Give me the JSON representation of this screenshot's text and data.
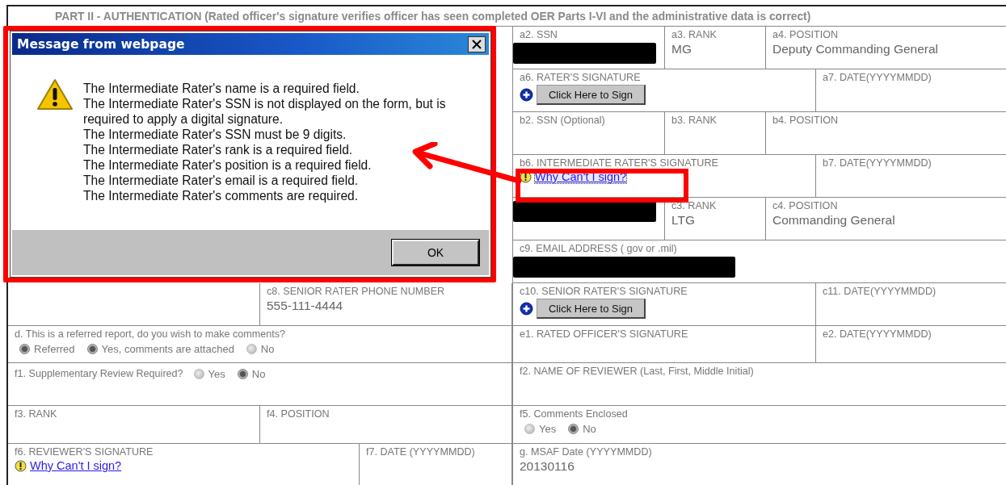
{
  "form": {
    "title": "PART II - AUTHENTICATION (Rated officer's signature verifies officer has seen completed OER Parts I-VI and the administrative data is correct)",
    "top_right_rows": [
      [
        {
          "kind": "redacted",
          "label": "a2. SSN"
        },
        {
          "kind": "field",
          "label": "a3. RANK",
          "value": "MG"
        },
        {
          "kind": "field",
          "label": "a4. POSITION",
          "value": "Deputy Commanding General"
        }
      ],
      [
        {
          "kind": "sign",
          "label": "a6. RATER'S SIGNATURE",
          "button": "Click Here to Sign"
        },
        {
          "kind": "field",
          "label": "a7. DATE(YYYYMMDD)"
        }
      ],
      [
        {
          "kind": "field",
          "label": "b2. SSN (Optional)"
        },
        {
          "kind": "field",
          "label": "b3. RANK"
        },
        {
          "kind": "field",
          "label": "b4. POSITION"
        }
      ],
      [
        {
          "kind": "help",
          "label": "b6. INTERMEDIATE RATER'S SIGNATURE",
          "link": "Why Can't I sign?"
        },
        {
          "kind": "field",
          "label": "b7. DATE(YYYYMMDD)"
        }
      ],
      [
        {
          "kind": "redacted"
        },
        {
          "kind": "field",
          "label": "c3. RANK",
          "value": "LTG"
        },
        {
          "kind": "field",
          "label": "c4. POSITION",
          "value": "Commanding General"
        }
      ],
      [
        {
          "kind": "redacted",
          "label": "c9. EMAIL ADDRESS ( gov or .mil)"
        }
      ]
    ],
    "bottom_rows": [
      {
        "left": [
          {
            "kind": "field"
          },
          {
            "kind": "field",
            "label": "c8. SENIOR RATER PHONE NUMBER",
            "value": "555-111-4444"
          }
        ],
        "right": [
          {
            "kind": "sign",
            "label": "c10. SENIOR RATER'S SIGNATURE",
            "button": "Click Here to Sign"
          },
          {
            "kind": "field",
            "label": "c11. DATE(YYYYMMDD)"
          }
        ]
      },
      {
        "left": [
          {
            "kind": "radio",
            "label": "d. This is a referred report, do you wish to make comments?",
            "options": [
              {
                "label": "Referred",
                "selected": true
              },
              {
                "label": "Yes, comments are attached",
                "selected": true
              },
              {
                "label": "No",
                "selected": false
              }
            ]
          }
        ],
        "right": [
          {
            "kind": "field",
            "label": "e1. RATED OFFICER'S SIGNATURE"
          },
          {
            "kind": "field",
            "label": "e2. DATE(YYYYMMDD)"
          }
        ]
      },
      {
        "left": [
          {
            "kind": "radio_inline",
            "label": "f1. Supplementary Review Required?",
            "options": [
              {
                "label": "Yes",
                "selected": false
              },
              {
                "label": "No",
                "selected": true
              }
            ]
          }
        ],
        "right": [
          {
            "kind": "field",
            "label": "f2. NAME OF REVIEWER (Last, First, Middle Initial)"
          }
        ]
      },
      {
        "left": [
          {
            "kind": "field",
            "label": "f3. RANK"
          },
          {
            "kind": "field",
            "label": "f4. POSITION"
          }
        ],
        "right": [
          {
            "kind": "radio",
            "label": "f5. Comments Enclosed",
            "options": [
              {
                "label": "Yes",
                "selected": false
              },
              {
                "label": "No",
                "selected": true
              }
            ]
          }
        ]
      },
      {
        "left": [
          {
            "kind": "help",
            "label": "f6. REVIEWER'S SIGNATURE",
            "link": "Why Can't I sign?"
          },
          {
            "kind": "field",
            "label": "f7. DATE (YYYYMMDD)"
          }
        ],
        "right": [
          {
            "kind": "field",
            "label": "g. MSAF Date (YYYYMMDD)",
            "value": "20130116"
          }
        ]
      }
    ]
  },
  "dialog": {
    "title": "Message from webpage",
    "messages": [
      "The Intermediate Rater's name is a required field.",
      "The Intermediate Rater's SSN is not displayed on the form, but is required to apply a digital signature.",
      "The Intermediate Rater's SSN must be 9 digits.",
      "The Intermediate Rater's rank is a required field.",
      "The Intermediate Rater's position is a required field.",
      "The Intermediate Rater's email is a required field.",
      "The Intermediate Rater's comments are required."
    ],
    "button": "OK"
  }
}
